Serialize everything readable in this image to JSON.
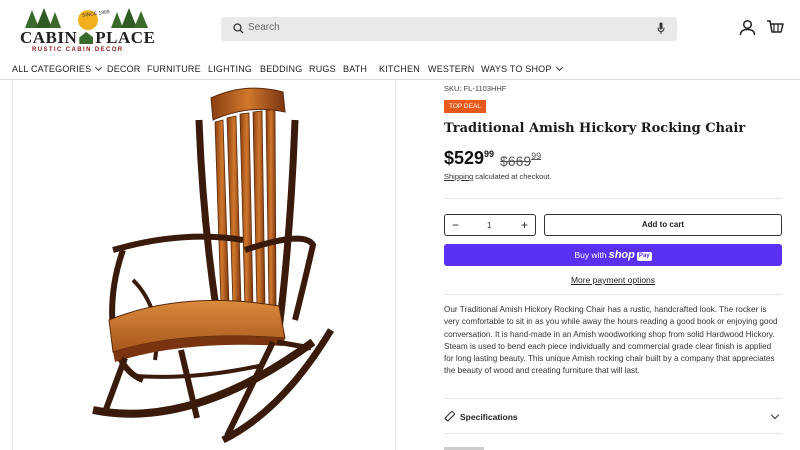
{
  "header": {
    "logo": {
      "main_left": "CABIN",
      "main_right": "PLACE",
      "tagline": "RUSTIC CABIN DECOR",
      "since": "SINCE 1989"
    },
    "search_placeholder": "Search",
    "icons": {
      "search": "search-icon",
      "mic": "microphone-icon",
      "account": "user-icon",
      "cart": "cart-icon"
    }
  },
  "nav": {
    "items": [
      {
        "label": "ALL CATEGORIES",
        "has_dropdown": true
      },
      {
        "label": "DECOR"
      },
      {
        "label": "FURNITURE"
      },
      {
        "label": "LIGHTING"
      },
      {
        "label": "BEDDING"
      },
      {
        "label": "RUGS"
      },
      {
        "label": "BATH"
      },
      {
        "label": "KITCHEN"
      },
      {
        "label": "WESTERN"
      },
      {
        "label": "WAYS TO SHOP",
        "has_dropdown": true
      }
    ]
  },
  "product": {
    "sku": "SKU: FL-1103HHF",
    "badge": "TOP DEAL",
    "title": "Traditional Amish Hickory Rocking Chair",
    "price_main": "$529",
    "price_cents": "99",
    "old_price_main": "$669",
    "old_price_cents": "99",
    "shipping_link": "Shipping",
    "shipping_text": "calculated at checkout.",
    "quantity": "1",
    "qty_minus": "−",
    "qty_plus": "+",
    "add_to_cart": "Add to cart",
    "buy_with": "Buy with",
    "shop_word": "shop",
    "pay_word": "Pay",
    "more_payment": "More payment options",
    "description": "Our Traditional Amish Hickory Rocking Chair has a rustic, handcrafted look. The rocker is very comfortable to sit in as you while away the hours reading a good book or enjoying good conversation. It is hand-made in an Amish woodworking shop from solid Hardwood Hickory. Steam is used to bend each piece individually and commercial grade clear finish is applied for long lasting beauty. This unique Amish rocking chair built by a company that appreciates the beauty of wood and creating furniture that will last.",
    "accordion_label": "Specifications"
  },
  "colors": {
    "badge": "#e85a1b",
    "shop_pay": "#5a31f4",
    "search_bg": "#e9e9e9"
  }
}
